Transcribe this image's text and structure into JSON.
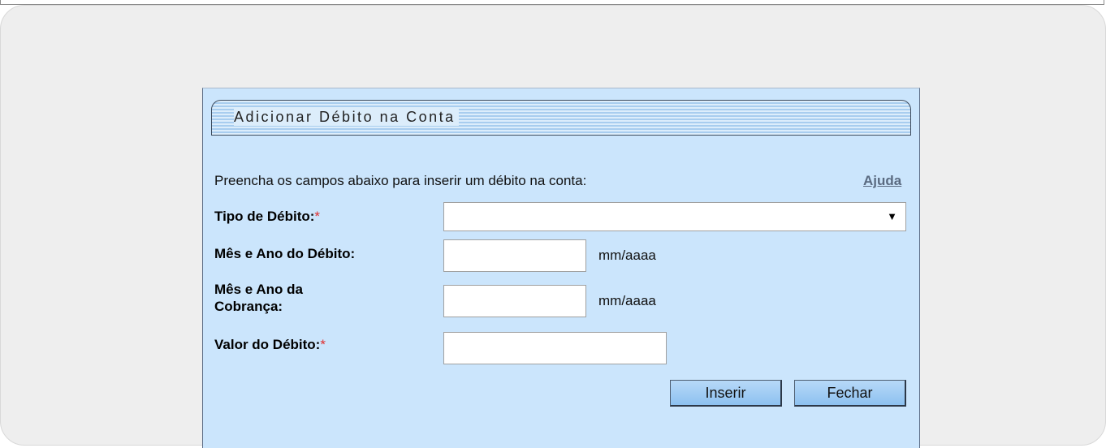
{
  "form": {
    "title": "Adicionar Débito na Conta",
    "intro": "Preencha os campos abaixo para inserir um débito na conta:",
    "help_link": "Ajuda",
    "required_mark": "*",
    "fields": {
      "tipo_debito": {
        "label": "Tipo de Débito:",
        "value": ""
      },
      "mes_ano_debito": {
        "label": "Mês e Ano do Débito:",
        "value": "",
        "hint": "mm/aaaa"
      },
      "mes_ano_cobranca": {
        "label_line1": "Mês e Ano da",
        "label_line2": "Cobrança:",
        "value": "",
        "hint": "mm/aaaa"
      },
      "valor_debito": {
        "label": "Valor do Débito:",
        "value": ""
      }
    },
    "buttons": {
      "insert": "Inserir",
      "close": "Fechar"
    }
  }
}
